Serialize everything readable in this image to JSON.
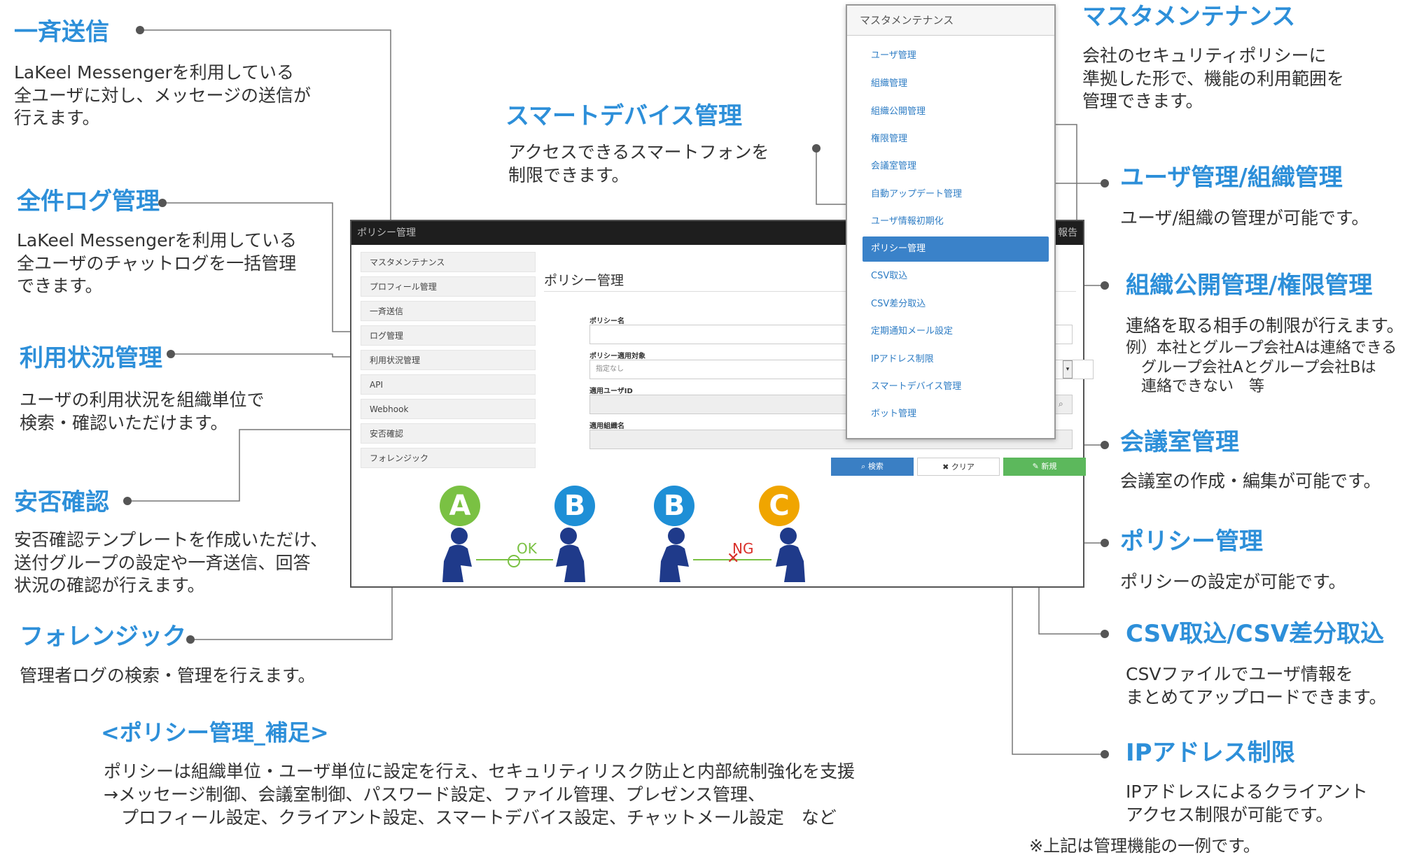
{
  "features_left": [
    {
      "title": "一斉送信",
      "desc": "LaKeel Messengerを利用している\n全ユーザに対し、メッセージの送信が\n行えます。"
    },
    {
      "title": "全件ログ管理",
      "desc": "LaKeel Messengerを利用している\n全ユーザのチャットログを一括管理\nできます。"
    },
    {
      "title": "利用状況管理",
      "desc": "ユーザの利用状況を組織単位で\n検索・確認いただけます。"
    },
    {
      "title": "安否確認",
      "desc": "安否確認テンプレートを作成いただけ、\n送付グループの設定や一斉送信、回答\n状況の確認が行えます。"
    },
    {
      "title": "フォレンジック",
      "desc": "管理者ログの検索・管理を行えます。"
    }
  ],
  "feature_center": {
    "title": "スマートデバイス管理",
    "desc": "アクセスできるスマートフォンを\n制限できます。"
  },
  "features_right": [
    {
      "title": "マスタメンテナンス",
      "desc": "会社のセキュリティポリシーに\n準拠した形で、機能の利用範囲を\n管理できます。"
    },
    {
      "title": "ユーザ管理/組織管理",
      "desc": "ユーザ/組織の管理が可能です。"
    },
    {
      "title": "組織公開管理/権限管理",
      "desc": "連絡を取る相手の制限が行えます。",
      "note": "例）本社とグループ会社Aは連絡できる\n　グループ会社Aとグループ会社Bは\n　連絡できない　等"
    },
    {
      "title": "会議室管理",
      "desc": "会議室の作成・編集が可能です。"
    },
    {
      "title": "ポリシー管理",
      "desc": "ポリシーの設定が可能です。"
    },
    {
      "title": "CSV取込/CSV差分取込",
      "desc": "CSVファイルでユーザ情報を\nまとめてアップロードできます。"
    },
    {
      "title": "IPアドレス制限",
      "desc": "IPアドレスによるクライアント\nアクセス制限が可能です。"
    }
  ],
  "supplement": {
    "title": "<ポリシー管理_補足>",
    "body": "ポリシーは組織単位・ユーザ単位に設定を行え、セキュリティリスク防止と内部統制強化を支援\n→メッセージ制御、会議室制御、パスワード設定、ファイル管理、プレゼンス管理、\n　プロフィール設定、クライアント設定、スマートデバイス設定、チャットメール設定　など"
  },
  "footnote": "※上記は管理機能の一例です。",
  "screenshot": {
    "window_title": "ポリシー管理",
    "top_right": "報告",
    "sidebar": [
      "マスタメンテナンス",
      "プロフィール管理",
      "一斉送信",
      "ログ管理",
      "利用状況管理",
      "API",
      "Webhook",
      "安否確認",
      "フォレンジック"
    ],
    "page_title": "ポリシー管理",
    "form": {
      "policy_name_label": "ポリシー名",
      "target_label": "ポリシー適用対象",
      "target_value": "指定なし",
      "user_id_label": "適用ユーザID",
      "org_name_label": "適用組織名"
    },
    "buttons": {
      "search": "検索",
      "clear": "クリア",
      "new": "新規"
    },
    "figure_labels": {
      "ok": "OK",
      "ng": "NG",
      "a": "A",
      "b": "B",
      "c": "C"
    }
  },
  "menu": {
    "header": "マスタメンテナンス",
    "items": [
      "ユーザ管理",
      "組織管理",
      "組織公開管理",
      "権限管理",
      "会議室管理",
      "自動アップデート管理",
      "ユーザ情報初期化",
      "ポリシー管理",
      "CSV取込",
      "CSV差分取込",
      "定期通知メール設定",
      "IPアドレス制限",
      "スマートデバイス管理",
      "ボット管理"
    ],
    "active_index": 7
  },
  "colors": {
    "title": "#2d8fd9",
    "letter_a": "#7ac143",
    "letter_b": "#1e8fd6",
    "letter_c": "#f0a500",
    "search_btn": "#3a7fc4",
    "new_btn": "#5cb85c",
    "person": "#1f3a8a"
  }
}
